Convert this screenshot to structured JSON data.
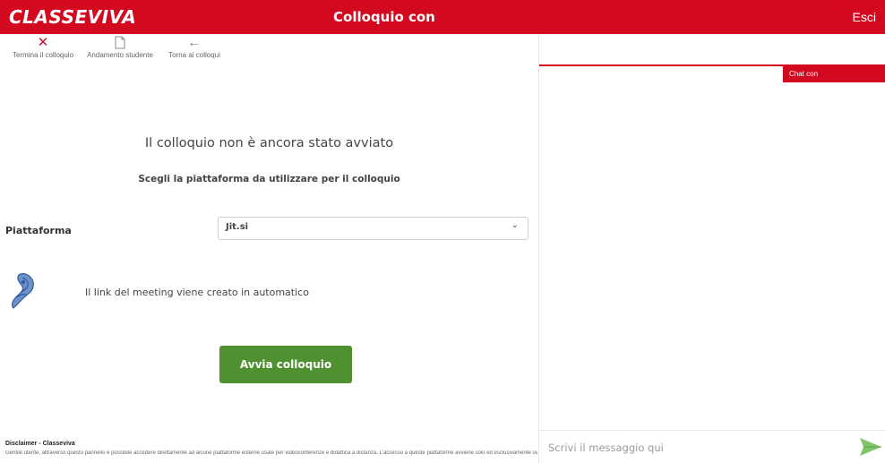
{
  "header": {
    "logo_text": "CLASSEVIVA",
    "title": "Colloquio con",
    "logout_label": "Esci"
  },
  "toolbar": {
    "end_label": "Termina il colloquio",
    "progress_label": "Andamento studente",
    "back_label": "Torna ai colloqui"
  },
  "main": {
    "status_title": "Il colloquio non è ancora stato avviato",
    "status_subtitle": "Scegli la piattaforma da utilizzare per il colloquio",
    "platform_label": "Piattaforma",
    "platform_value": "Jit.si",
    "auto_note": "Il link del meeting viene creato in automatico",
    "start_button": "Avvia colloquio"
  },
  "disclaimer": {
    "title": "Disclaimer - Classeviva",
    "text": "Gentile utente, attraverso questo pannello è possibile accedere direttamente ad alcune piattaforme esterne usate per videoconferenze e didattica a distanza. L'accesso a queste piattaforme avviene solo ed esclusivamente ove"
  },
  "chat": {
    "tab_label": "Chat con",
    "input_placeholder": "Scrivi il messaggio qui"
  },
  "colors": {
    "brand_red": "#d2091f",
    "button_green": "#4f9131"
  },
  "icons": {
    "end": "close-icon",
    "progress": "document-icon",
    "back": "arrow-left-icon",
    "select": "chevron-down-icon",
    "platform": "jitsi-logo",
    "send": "send-icon"
  }
}
